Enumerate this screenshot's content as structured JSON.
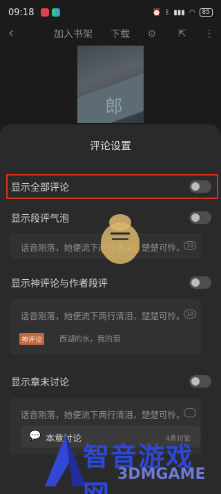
{
  "status": {
    "time": "09:18",
    "battery": "85"
  },
  "nav": {
    "add_shelf": "加入书架",
    "download": "下载"
  },
  "sheet": {
    "title": "评论设置",
    "rows": [
      {
        "label": "显示全部评论"
      },
      {
        "label": "显示段评气泡"
      },
      {
        "label": "显示神评论与作者段评"
      },
      {
        "label": "显示章末讨论"
      }
    ],
    "previews": [
      {
        "text": "话音刚落，她便流下两行清泪，楚楚可怜。",
        "bubble": "10"
      },
      {
        "text": "话音刚落，她便流下两行清泪，楚楚可怜。",
        "bubble": "10"
      },
      {
        "text": "话音刚落，她便流下两行清泪，楚楚可怜。",
        "bubble": ""
      }
    ],
    "god_tag": "神评论",
    "god_comment": "西湖的水，我的泪",
    "chapter_discussion": {
      "label": "本章讨论",
      "count": "4条讨论"
    }
  },
  "watermark": {
    "title": "智音游戏网",
    "sub": "3DMGAME"
  },
  "colors": {
    "highlight": "#d8331f",
    "tag": "#c0693c",
    "watermark": "#2d47d8"
  }
}
